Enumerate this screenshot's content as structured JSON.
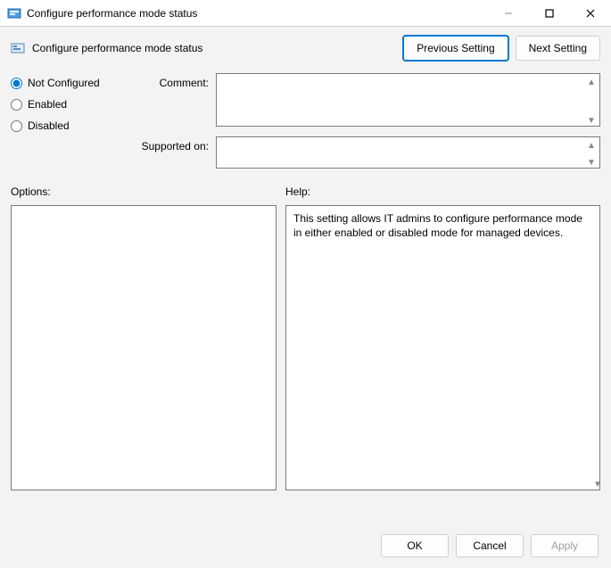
{
  "window": {
    "title": "Configure performance mode status"
  },
  "header": {
    "title": "Configure performance mode status",
    "prev_button": "Previous Setting",
    "next_button": "Next Setting"
  },
  "radios": {
    "not_configured": "Not Configured",
    "enabled": "Enabled",
    "disabled": "Disabled",
    "selected": "not_configured"
  },
  "fields": {
    "comment_label": "Comment:",
    "comment_value": "",
    "supported_label": "Supported on:",
    "supported_value": ""
  },
  "panels": {
    "options_label": "Options:",
    "help_label": "Help:",
    "options_text": "",
    "help_text": "This setting allows IT admins to configure performance mode in either enabled or disabled mode for managed devices."
  },
  "footer": {
    "ok": "OK",
    "cancel": "Cancel",
    "apply": "Apply"
  }
}
